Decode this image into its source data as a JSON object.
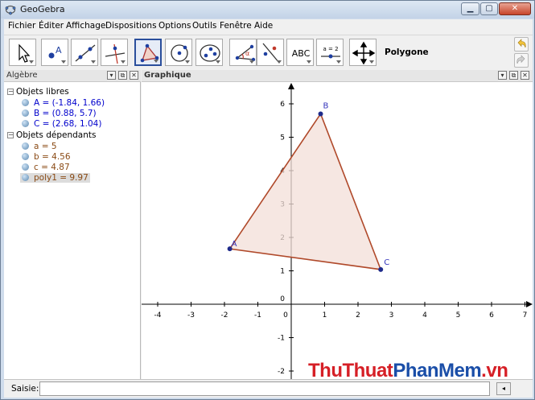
{
  "window": {
    "title": "GeoGebra"
  },
  "menu": [
    "Fichier",
    "Éditer",
    "Affichage",
    "Dispositions",
    "Options",
    "Outils",
    "Fenêtre",
    "Aide"
  ],
  "toolbar": {
    "tools": [
      "move",
      "point",
      "line",
      "perpendicular",
      "polygon",
      "circle",
      "conic",
      "angle",
      "reflect",
      "text",
      "slider",
      "translate-view"
    ],
    "selected_tool": "polygon",
    "text_tool_label": "ABC",
    "slider_tool_label": "a = 2",
    "selected_tool_name": "Polygone"
  },
  "algebra": {
    "title": "Algèbre",
    "free_group": "Objets libres",
    "free_objects": [
      "A = (-1.84, 1.66)",
      "B = (0.88, 5.7)",
      "C = (2.68, 1.04)"
    ],
    "dependent_group": "Objets dépendants",
    "dependent_objects": [
      "a = 5",
      "b = 4.56",
      "c = 4.87",
      "poly1 = 9.97"
    ],
    "selected_object": "poly1 = 9.97"
  },
  "graphics": {
    "title": "Graphique",
    "x_ticks": [
      "-4",
      "-3",
      "-2",
      "-1",
      "0",
      "1",
      "2",
      "3",
      "4",
      "5",
      "6",
      "7"
    ],
    "y_ticks": [
      "6",
      "5",
      "4",
      "3",
      "2",
      "1",
      "0",
      "-1",
      "-2"
    ],
    "points": [
      {
        "label": "A",
        "x": -1.84,
        "y": 1.66
      },
      {
        "label": "B",
        "x": 0.88,
        "y": 5.7
      },
      {
        "label": "C",
        "x": 2.68,
        "y": 1.04
      }
    ],
    "polygon_fill": "#f3dfd8",
    "polygon_stroke": "#b0492a",
    "point_color": "#1e2a8a",
    "label_color": "#3333bb"
  },
  "input": {
    "label": "Saisie:",
    "value": ""
  },
  "watermark": {
    "part1": "ThuThuat",
    "part2": "PhanMem",
    "part3": ".vn"
  }
}
